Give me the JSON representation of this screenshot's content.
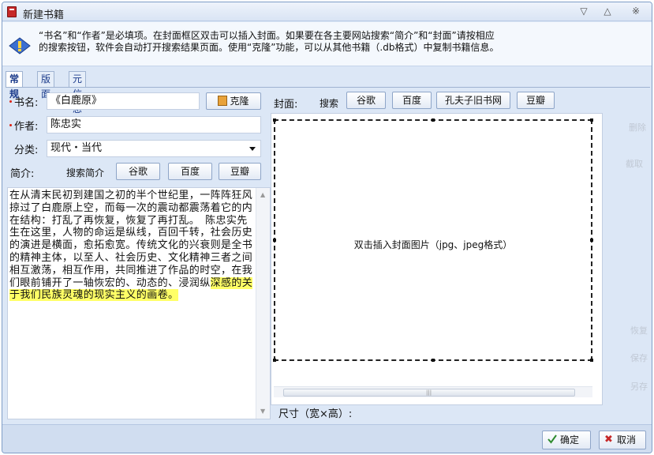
{
  "window": {
    "title": "新建书籍",
    "controls": [
      "▽",
      "△",
      "※"
    ]
  },
  "info": {
    "line1": "“书名”和“作者”是必填项。在封面框区双击可以插入封面。如果要在各主要网站搜索“简介”和“封面”请按相应",
    "line2": "的搜索按钮，软件会自动打开搜索结果页面。使用“克隆”功能，可以从其他书籍（.db格式）中复制书籍信息。"
  },
  "tabs": [
    "常规",
    "版面",
    "元信息"
  ],
  "form": {
    "title_label": "书名:",
    "title_value": "《白鹿原》",
    "clone_button": "克隆",
    "author_label": "作者:",
    "author_value": "陈忠实",
    "category_label": "分类:",
    "category_value": "现代・当代",
    "intro_label": "简介:",
    "intro_search_label": "搜索简介",
    "intro_buttons": [
      "谷歌",
      "百度",
      "豆瓣"
    ]
  },
  "intro_text": {
    "body": "在从清末民初到建国之初的半个世纪里，一阵阵狂风掠过了白鹿原上空，而每一次的震动都震荡着它的内在结构：打乱了再恢复，恢复了再打乱。　陈忠实先生在这里，人物的命运是纵线，百回千转，社会历史的演进是横面，愈拓愈宽。传统文化的兴衰则是全书的精神主体，以至人、社会历史、文化精神三者之间相互激荡，相互作用，共同推进了作品的时空，在我们眼前铺开了一轴恢宏的、动态的、浸润纵深感的关于我们民族灵魂的现实主义的画卷。",
    "highlight": "深感的关于我们民族灵魂的现实主义的画卷。"
  },
  "cover": {
    "label": "封面:",
    "search_label": "搜索",
    "search_buttons": [
      "谷歌",
      "百度",
      "孔夫子旧书网",
      "豆瓣"
    ],
    "hint": "双击插入封面图片（jpg、jpeg格式）",
    "size_label": "尺寸（宽×高）:"
  },
  "faded_side": [
    "删除",
    "截取",
    "恢复",
    "保存",
    "另存"
  ],
  "footer": {
    "ok_label": "确定",
    "cancel_label": "取消"
  }
}
